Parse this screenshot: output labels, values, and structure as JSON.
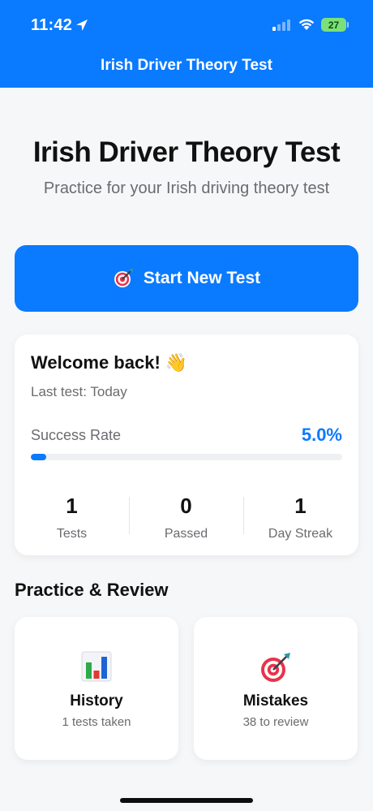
{
  "status_bar": {
    "time": "11:42",
    "battery": "27",
    "location_icon": "location-arrow-icon",
    "signal_icon": "cellular-signal-icon",
    "wifi_icon": "wifi-icon"
  },
  "nav": {
    "title": "Irish Driver Theory Test"
  },
  "hero": {
    "title": "Irish Driver Theory Test",
    "subtitle": "Practice for your Irish driving theory test"
  },
  "start_button": {
    "label": "Start New Test",
    "icon": "target-icon"
  },
  "welcome": {
    "title": "Welcome back! 👋",
    "last_test": "Last test: Today",
    "success_rate_label": "Success Rate",
    "success_rate_value": "5.0%",
    "success_rate_fraction": 0.05,
    "stats": [
      {
        "value": "1",
        "label": "Tests"
      },
      {
        "value": "0",
        "label": "Passed"
      },
      {
        "value": "1",
        "label": "Day Streak"
      }
    ]
  },
  "practice": {
    "title": "Practice & Review",
    "tiles": [
      {
        "title": "History",
        "subtitle": "1 tests taken",
        "icon": "bar-chart-icon"
      },
      {
        "title": "Mistakes",
        "subtitle": "38 to review",
        "icon": "target-icon"
      }
    ]
  },
  "colors": {
    "accent": "#0a7aff",
    "background": "#f6f7f9",
    "battery": "#7be07b"
  }
}
